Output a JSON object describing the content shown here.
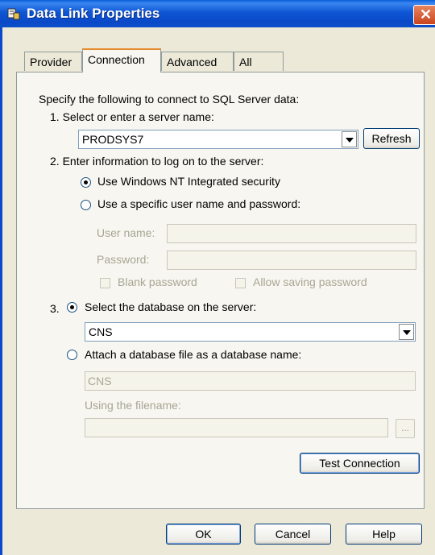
{
  "window": {
    "title": "Data Link Properties"
  },
  "tabs": [
    {
      "label": "Provider"
    },
    {
      "label": "Connection"
    },
    {
      "label": "Advanced"
    },
    {
      "label": "All"
    }
  ],
  "connection": {
    "intro": "Specify the following to connect to SQL Server data:",
    "step1_label": "1. Select or enter a server name:",
    "server_name": "PRODSYS7",
    "refresh_label": "Refresh",
    "step2_label": "2. Enter information to log on to the server:",
    "opt_nt_security": "Use Windows NT Integrated security",
    "opt_specific_user": "Use a specific user name and password:",
    "user_name_label": "User name:",
    "password_label": "Password:",
    "blank_password_label": "Blank password",
    "allow_saving_label": "Allow saving password",
    "step3_number": "3.",
    "opt_select_db": "Select the database on the server:",
    "database": "CNS",
    "opt_attach_db": "Attach a database file as a database name:",
    "attach_db_name": "CNS",
    "filename_label": "Using the filename:",
    "browse_label": "...",
    "test_connection_label": "Test Connection"
  },
  "footer": {
    "ok_label": "OK",
    "cancel_label": "Cancel",
    "help_label": "Help"
  },
  "colors": {
    "titlebar": "#0A49C8",
    "window_bg": "#ECE9D8",
    "close_button": "#C9451F"
  }
}
